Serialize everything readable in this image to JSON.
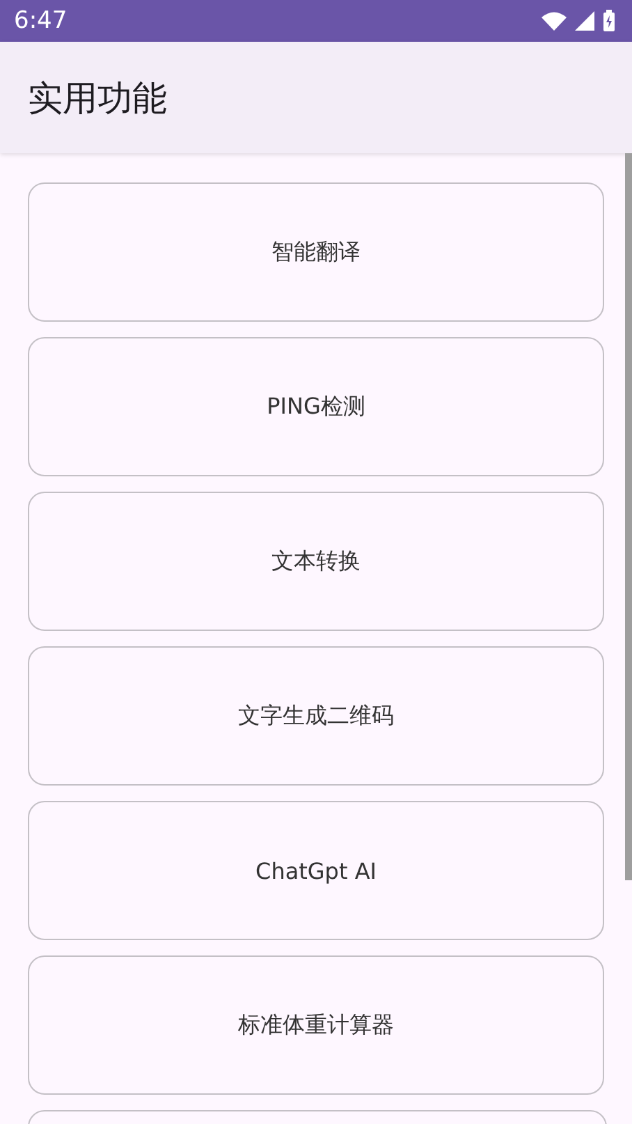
{
  "status_bar": {
    "time": "6:47"
  },
  "app_bar": {
    "title": "实用功能"
  },
  "items": [
    {
      "kind": "card",
      "label": "智能翻译"
    },
    {
      "kind": "card",
      "label": "PING检测"
    },
    {
      "kind": "card",
      "label": "文本转换"
    },
    {
      "kind": "card",
      "label": "文字生成二维码"
    },
    {
      "kind": "card",
      "label": "ChatGpt AI"
    },
    {
      "kind": "card",
      "label": "标准体重计算器"
    },
    {
      "kind": "cut_off"
    }
  ]
}
